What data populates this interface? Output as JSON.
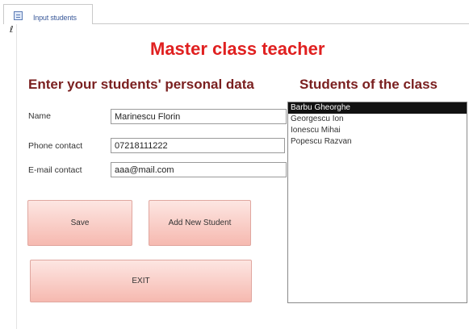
{
  "window": {
    "tab_label": "Input students",
    "selector_glyph": "ℓ"
  },
  "form": {
    "title": "Master class teacher",
    "left_heading": "Enter your students' personal data",
    "right_heading": "Students of the class",
    "fields": {
      "name": {
        "label": "Name",
        "value": "Marinescu Florin"
      },
      "phone": {
        "label": "Phone contact",
        "value": "07218111222"
      },
      "email": {
        "label": "E-mail contact",
        "value": "aaa@mail.com"
      }
    },
    "buttons": {
      "save": "Save",
      "add_new": "Add New Student",
      "exit": "EXIT"
    }
  },
  "students": [
    "Barbu Gheorghe",
    "Georgescu Ion",
    "Ionescu Mihai",
    "Popescu Razvan"
  ],
  "selected_student_index": 0
}
